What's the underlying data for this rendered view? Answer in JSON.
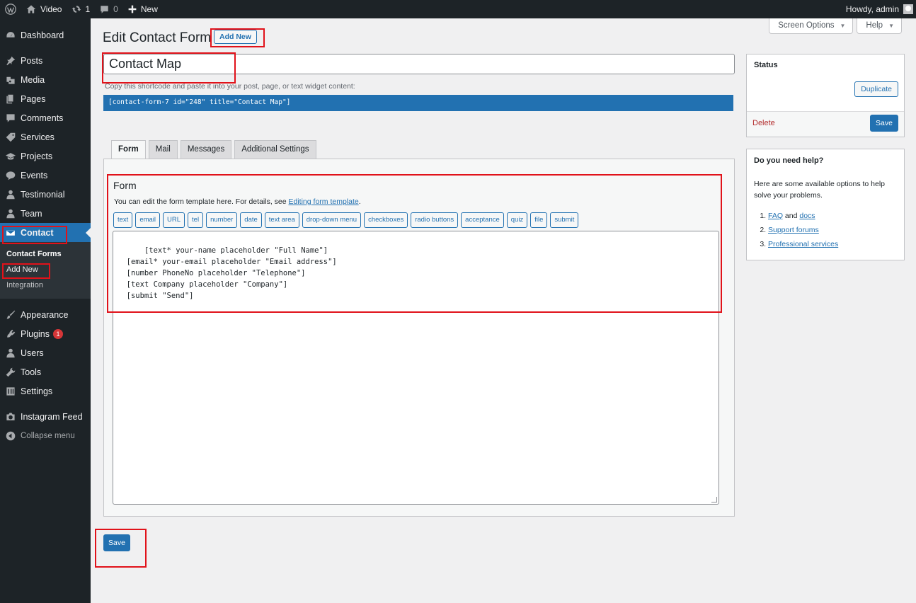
{
  "adminbar": {
    "site_name": "Video",
    "updates_count": "1",
    "comments_count": "0",
    "new_label": "New",
    "howdy": "Howdy, admin"
  },
  "sidebar": {
    "items": [
      {
        "label": "Dashboard",
        "icon": "dashboard-icon"
      },
      {
        "label": "Posts",
        "icon": "pin-icon"
      },
      {
        "label": "Media",
        "icon": "media-icon"
      },
      {
        "label": "Pages",
        "icon": "pages-icon"
      },
      {
        "label": "Comments",
        "icon": "comment-icon"
      },
      {
        "label": "Services",
        "icon": "tag-icon"
      },
      {
        "label": "Projects",
        "icon": "graduation-cap-icon"
      },
      {
        "label": "Events",
        "icon": "chat-icon"
      },
      {
        "label": "Testimonial",
        "icon": "person-icon"
      },
      {
        "label": "Team",
        "icon": "person-icon"
      },
      {
        "label": "Contact",
        "icon": "envelope-icon"
      }
    ],
    "submenu": [
      "Contact Forms",
      "Add New",
      "Integration"
    ],
    "items_after": [
      {
        "label": "Appearance",
        "icon": "brush-icon"
      },
      {
        "label": "Plugins",
        "icon": "plug-icon",
        "badge": "1"
      },
      {
        "label": "Users",
        "icon": "users-icon"
      },
      {
        "label": "Tools",
        "icon": "wrench-icon"
      },
      {
        "label": "Settings",
        "icon": "settings-icon"
      },
      {
        "label": "Instagram Feed",
        "icon": "camera-icon"
      }
    ],
    "collapse_label": "Collapse menu"
  },
  "screen_meta": {
    "screen_options": "Screen Options",
    "help": "Help"
  },
  "header": {
    "title": "Edit Contact Form",
    "add_new": "Add New"
  },
  "form": {
    "title_value": "Contact Map",
    "shortcode_label": "Copy this shortcode and paste it into your post, page, or text widget content:",
    "shortcode": "[contact-form-7 id=\"248\" title=\"Contact Map\"]"
  },
  "tabs": [
    "Form",
    "Mail",
    "Messages",
    "Additional Settings"
  ],
  "panel": {
    "heading": "Form",
    "desc_prefix": "You can edit the form template here. For details, see ",
    "desc_link": "Editing form template",
    "desc_suffix": ".",
    "tag_buttons": [
      "text",
      "email",
      "URL",
      "tel",
      "number",
      "date",
      "text area",
      "drop-down menu",
      "checkboxes",
      "radio buttons",
      "acceptance",
      "quiz",
      "file",
      "submit"
    ],
    "template": "[text* your-name placeholder \"Full Name\"]\n  [email* your-email placeholder \"Email address\"]\n  [number PhoneNo placeholder \"Telephone\"]\n  [text Company placeholder \"Company\"]\n  [submit \"Send\"]"
  },
  "save_label": "Save",
  "status_box": {
    "title": "Status",
    "duplicate": "Duplicate",
    "delete": "Delete",
    "save": "Save"
  },
  "help_box": {
    "title": "Do you need help?",
    "intro": "Here are some available options to help solve your problems.",
    "faq": "FAQ",
    "and": " and ",
    "docs": "docs",
    "support": "Support forums",
    "professional": "Professional services"
  },
  "colors": {
    "accent": "#2271b1",
    "admin_dark": "#1d2327",
    "annotation_red": "#e1121a",
    "delete_red": "#b32d2e"
  }
}
